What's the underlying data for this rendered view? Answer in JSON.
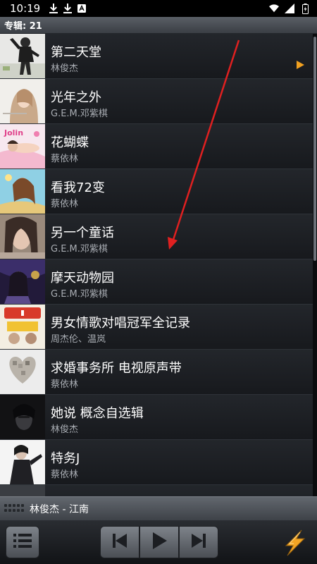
{
  "status_bar": {
    "time": "10:19",
    "left_icons": [
      "download-icon",
      "download-icon",
      "app-notification-icon"
    ],
    "right_icons": [
      "wifi-icon",
      "cellular-signal-icon",
      "battery-icon"
    ]
  },
  "section_header": {
    "label": "专辑: 21"
  },
  "albums": [
    {
      "title": "第二天堂",
      "artist": "林俊杰",
      "now_playing": true
    },
    {
      "title": "光年之外",
      "artist": "G.E.M.邓紫棋"
    },
    {
      "title": "花蝴蝶",
      "artist": "蔡依林"
    },
    {
      "title": "看我72变",
      "artist": "蔡依林"
    },
    {
      "title": "另一个童话",
      "artist": "G.E.M.邓紫棋"
    },
    {
      "title": "摩天动物园",
      "artist": "G.E.M.邓紫棋"
    },
    {
      "title": "男女情歌对唱冠军全记录",
      "artist": "周杰伦、温岚"
    },
    {
      "title": "求婚事务所 电视原声带",
      "artist": "蔡依林"
    },
    {
      "title": "她说 概念自选辑",
      "artist": "林俊杰"
    },
    {
      "title": "特务J",
      "artist": "蔡依林"
    }
  ],
  "now_playing_bar": {
    "text": "林俊杰 - 江南"
  },
  "controls": {
    "playlist_button": "list-icon",
    "previous_button": "skip-previous-icon",
    "play_button": "play-icon",
    "next_button": "skip-next-icon",
    "bolt_button": "lightning-bolt-icon"
  },
  "colors": {
    "accent": "#f0a020",
    "annotation_arrow": "#e02020"
  }
}
